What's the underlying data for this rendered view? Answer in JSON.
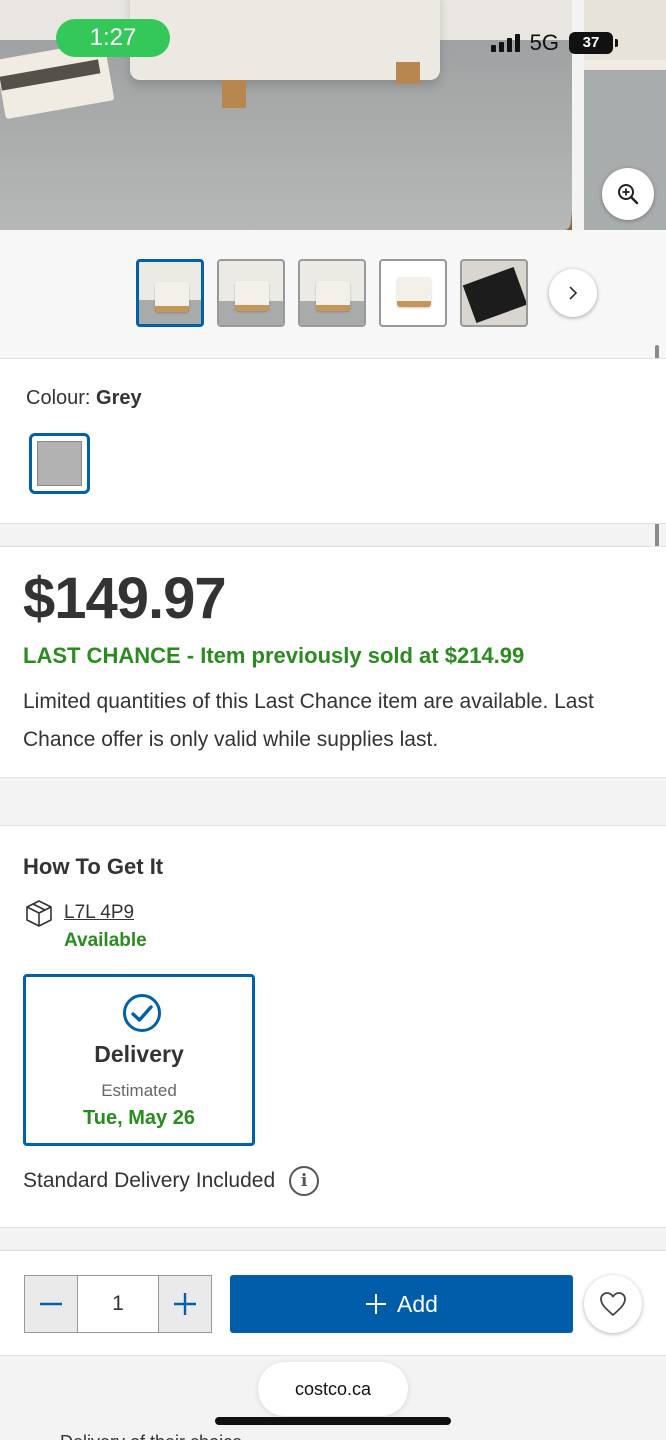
{
  "status_bar": {
    "time": "1:27",
    "network": "5G",
    "battery": "37"
  },
  "gallery": {
    "thumbnails": [
      "thumbnail-1",
      "thumbnail-2",
      "thumbnail-3",
      "thumbnail-4",
      "thumbnail-5"
    ],
    "active_index": 0
  },
  "colour": {
    "label": "Colour:",
    "value": "Grey",
    "swatch_color": "#b2b2b2"
  },
  "pricing": {
    "price": "$149.97",
    "last_chance": "LAST CHANCE - Item previously sold at $214.99",
    "description": "Limited quantities of this Last Chance item are available. Last Chance offer is only valid while supplies last."
  },
  "how_to_get": {
    "title": "How To Get It",
    "postal_code": "L7L 4P9",
    "availability": "Available",
    "delivery_label": "Delivery",
    "estimated_label": "Estimated",
    "estimated_date": "Tue, May 26",
    "standard_delivery": "Standard Delivery Included"
  },
  "cart": {
    "quantity": "1",
    "add_label": "Add"
  },
  "browser": {
    "url": "costco.ca"
  },
  "footer_peek": "Delivery of their choice"
}
